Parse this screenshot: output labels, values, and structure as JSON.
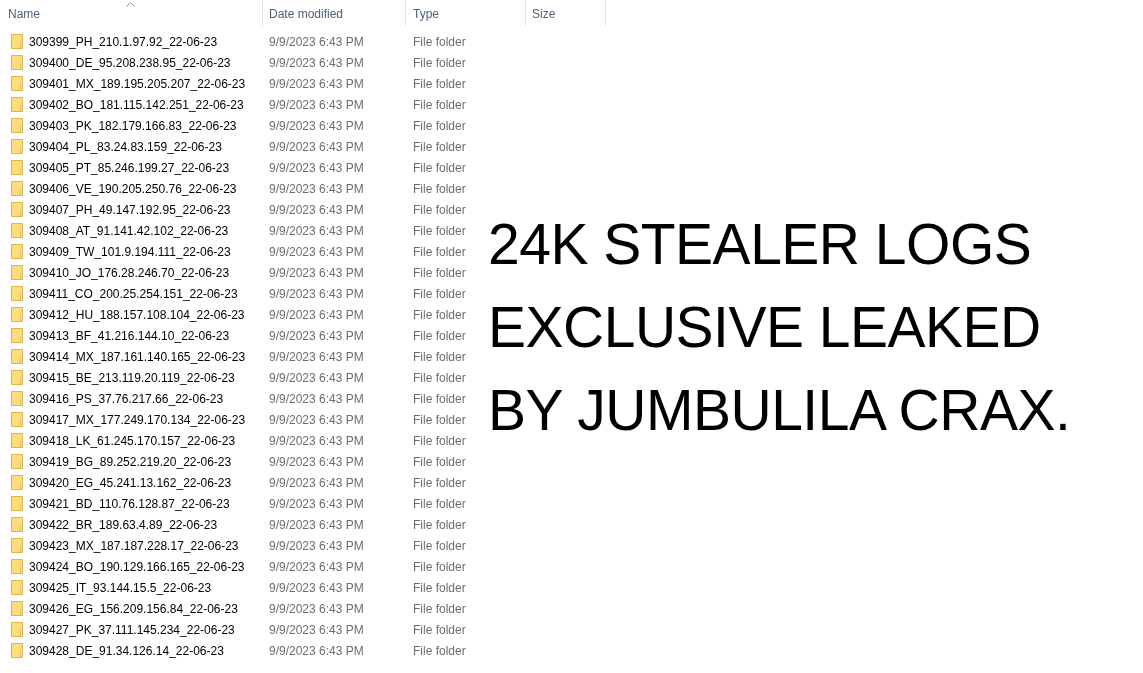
{
  "file_list": {
    "columns": [
      {
        "label": "Name",
        "sorted": true
      },
      {
        "label": "Date modified",
        "sorted": false
      },
      {
        "label": "Type",
        "sorted": false
      },
      {
        "label": "Size",
        "sorted": false
      }
    ],
    "rows": [
      {
        "name": "309399_PH_210.1.97.92_22-06-23",
        "date_modified": "9/9/2023 6:43 PM",
        "type": "File folder"
      },
      {
        "name": "309400_DE_95.208.238.95_22-06-23",
        "date_modified": "9/9/2023 6:43 PM",
        "type": "File folder"
      },
      {
        "name": "309401_MX_189.195.205.207_22-06-23",
        "date_modified": "9/9/2023 6:43 PM",
        "type": "File folder"
      },
      {
        "name": "309402_BO_181.115.142.251_22-06-23",
        "date_modified": "9/9/2023 6:43 PM",
        "type": "File folder"
      },
      {
        "name": "309403_PK_182.179.166.83_22-06-23",
        "date_modified": "9/9/2023 6:43 PM",
        "type": "File folder"
      },
      {
        "name": "309404_PL_83.24.83.159_22-06-23",
        "date_modified": "9/9/2023 6:43 PM",
        "type": "File folder"
      },
      {
        "name": "309405_PT_85.246.199.27_22-06-23",
        "date_modified": "9/9/2023 6:43 PM",
        "type": "File folder"
      },
      {
        "name": "309406_VE_190.205.250.76_22-06-23",
        "date_modified": "9/9/2023 6:43 PM",
        "type": "File folder"
      },
      {
        "name": "309407_PH_49.147.192.95_22-06-23",
        "date_modified": "9/9/2023 6:43 PM",
        "type": "File folder"
      },
      {
        "name": "309408_AT_91.141.42.102_22-06-23",
        "date_modified": "9/9/2023 6:43 PM",
        "type": "File folder"
      },
      {
        "name": "309409_TW_101.9.194.111_22-06-23",
        "date_modified": "9/9/2023 6:43 PM",
        "type": "File folder"
      },
      {
        "name": "309410_JO_176.28.246.70_22-06-23",
        "date_modified": "9/9/2023 6:43 PM",
        "type": "File folder"
      },
      {
        "name": "309411_CO_200.25.254.151_22-06-23",
        "date_modified": "9/9/2023 6:43 PM",
        "type": "File folder"
      },
      {
        "name": "309412_HU_188.157.108.104_22-06-23",
        "date_modified": "9/9/2023 6:43 PM",
        "type": "File folder"
      },
      {
        "name": "309413_BF_41.216.144.10_22-06-23",
        "date_modified": "9/9/2023 6:43 PM",
        "type": "File folder"
      },
      {
        "name": "309414_MX_187.161.140.165_22-06-23",
        "date_modified": "9/9/2023 6:43 PM",
        "type": "File folder"
      },
      {
        "name": "309415_BE_213.119.20.119_22-06-23",
        "date_modified": "9/9/2023 6:43 PM",
        "type": "File folder"
      },
      {
        "name": "309416_PS_37.76.217.66_22-06-23",
        "date_modified": "9/9/2023 6:43 PM",
        "type": "File folder"
      },
      {
        "name": "309417_MX_177.249.170.134_22-06-23",
        "date_modified": "9/9/2023 6:43 PM",
        "type": "File folder"
      },
      {
        "name": "309418_LK_61.245.170.157_22-06-23",
        "date_modified": "9/9/2023 6:43 PM",
        "type": "File folder"
      },
      {
        "name": "309419_BG_89.252.219.20_22-06-23",
        "date_modified": "9/9/2023 6:43 PM",
        "type": "File folder"
      },
      {
        "name": "309420_EG_45.241.13.162_22-06-23",
        "date_modified": "9/9/2023 6:43 PM",
        "type": "File folder"
      },
      {
        "name": "309421_BD_110.76.128.87_22-06-23",
        "date_modified": "9/9/2023 6:43 PM",
        "type": "File folder"
      },
      {
        "name": "309422_BR_189.63.4.89_22-06-23",
        "date_modified": "9/9/2023 6:43 PM",
        "type": "File folder"
      },
      {
        "name": "309423_MX_187.187.228.17_22-06-23",
        "date_modified": "9/9/2023 6:43 PM",
        "type": "File folder"
      },
      {
        "name": "309424_BO_190.129.166.165_22-06-23",
        "date_modified": "9/9/2023 6:43 PM",
        "type": "File folder"
      },
      {
        "name": "309425_IT_93.144.15.5_22-06-23",
        "date_modified": "9/9/2023 6:43 PM",
        "type": "File folder"
      },
      {
        "name": "309426_EG_156.209.156.84_22-06-23",
        "date_modified": "9/9/2023 6:43 PM",
        "type": "File folder"
      },
      {
        "name": "309427_PK_37.111.145.234_22-06-23",
        "date_modified": "9/9/2023 6:43 PM",
        "type": "File folder"
      },
      {
        "name": "309428_DE_91.34.126.14_22-06-23",
        "date_modified": "9/9/2023 6:43 PM",
        "type": "File folder"
      }
    ]
  },
  "overlay_caption": {
    "lines": [
      "24K STEALER LOGS",
      "EXCLUSIVE LEAKED",
      "BY JUMBULILA CRAX."
    ]
  }
}
